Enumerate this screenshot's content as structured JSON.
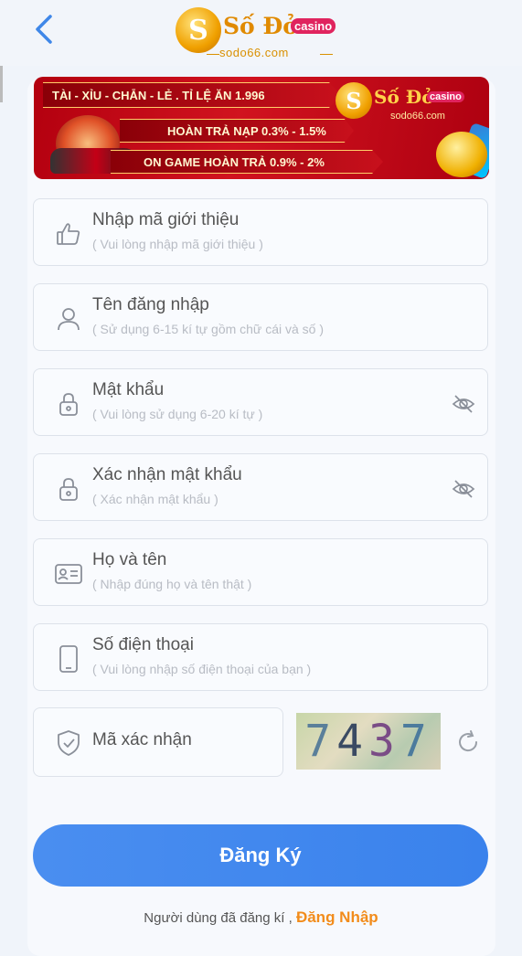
{
  "header": {
    "logo_text": "Số Đỏ",
    "logo_badge": "casino",
    "logo_domain": "sodo66.com"
  },
  "banner": {
    "line1": "TÀI - XỈU - CHẴN - LẺ . TỈ LỆ ĂN 1.996",
    "line2": "HOÀN TRẢ NẠP 0.3% - 1.5%",
    "line3": "ON GAME HOÀN TRẢ 0.9% - 2%",
    "logo_text": "Số Đỏ",
    "logo_badge": "casino",
    "logo_domain": "sodo66.com"
  },
  "form": {
    "referral": {
      "label": "Nhập mã giới thiệu",
      "placeholder": "( Vui lòng nhập mã giới thiệu )"
    },
    "username": {
      "label": "Tên đăng nhập",
      "placeholder": "( Sử dụng 6-15 kí tự gồm chữ cái và số )"
    },
    "password": {
      "label": "Mật khẩu",
      "placeholder": "( Vui lòng sử dụng 6-20 kí tự )"
    },
    "confirm_password": {
      "label": "Xác nhận mật khẩu",
      "placeholder": "( Xác nhận mật khẩu )"
    },
    "full_name": {
      "label": "Họ và tên",
      "placeholder": "( Nhập đúng họ và tên thật )"
    },
    "phone": {
      "label": "Số điện thoại",
      "placeholder": "( Vui lòng nhập số điện thoại của bạn )"
    },
    "captcha": {
      "label": "Mã xác nhận",
      "digits": [
        "7",
        "4",
        "3",
        "7"
      ]
    },
    "submit_label": "Đăng Ký"
  },
  "footer": {
    "prompt": "Người dùng đã đăng kí ,",
    "login_link": "Đăng Nhập"
  },
  "colors": {
    "primary": "#3a82ec",
    "accent": "#f28c1b",
    "banner_red": "#d1131f"
  }
}
